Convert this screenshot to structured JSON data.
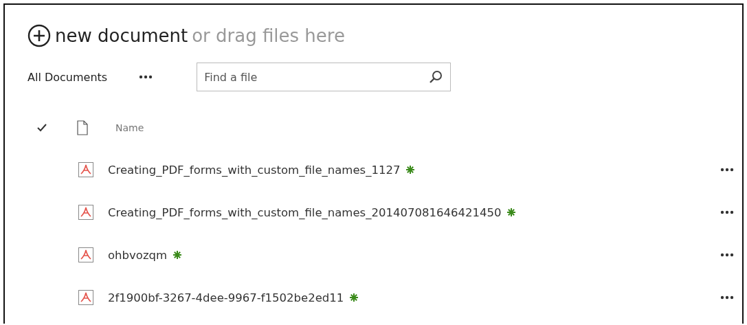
{
  "upload": {
    "action": "new document",
    "hint": "or drag files here"
  },
  "view": {
    "label": "All Documents"
  },
  "search": {
    "placeholder": "Find a file"
  },
  "table": {
    "columns": [
      "Name"
    ],
    "rows": [
      {
        "name": "Creating_PDF_forms_with_custom_file_names_1127",
        "new": true
      },
      {
        "name": "Creating_PDF_forms_with_custom_file_names_201407081646421450",
        "new": true
      },
      {
        "name": "ohbvozqm",
        "new": true
      },
      {
        "name": "2f1900bf-3267-4dee-9967-f1502be2ed11",
        "new": true
      }
    ]
  }
}
